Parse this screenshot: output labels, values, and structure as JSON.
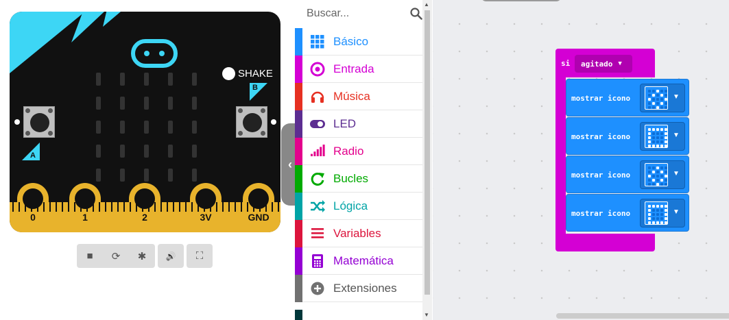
{
  "simulator": {
    "shake_label": "SHAKE",
    "button_a": "A",
    "button_b": "B",
    "pins": [
      "0",
      "1",
      "2",
      "3V",
      "GND"
    ],
    "toolbar": [
      {
        "icon": "stop-icon",
        "glyph": "■"
      },
      {
        "icon": "restart-icon",
        "glyph": "⟳"
      },
      {
        "icon": "debug-icon",
        "glyph": "✱"
      },
      {
        "icon": "sound-icon",
        "glyph": "🔊"
      },
      {
        "icon": "fullscreen-icon",
        "glyph": "⛶"
      }
    ]
  },
  "toolbox": {
    "search_placeholder": "Buscar...",
    "categories": [
      {
        "label": "Básico",
        "color": "#1e90ff",
        "icon": "grid-icon"
      },
      {
        "label": "Entrada",
        "color": "#d400d4",
        "icon": "target-icon"
      },
      {
        "label": "Música",
        "color": "#e63022",
        "icon": "headphones-icon"
      },
      {
        "label": "LED",
        "color": "#5c2d91",
        "icon": "toggle-icon"
      },
      {
        "label": "Radio",
        "color": "#e3008c",
        "icon": "signal-bars-icon"
      },
      {
        "label": "Bucles",
        "color": "#00aa00",
        "icon": "loop-icon"
      },
      {
        "label": "Lógica",
        "color": "#00a4a6",
        "icon": "shuffle-icon"
      },
      {
        "label": "Variables",
        "color": "#dc143c",
        "icon": "lines-icon"
      },
      {
        "label": "Matemática",
        "color": "#9400d3",
        "icon": "calculator-icon"
      },
      {
        "label": "Extensiones",
        "color": "#717171",
        "icon": "plus-circle-icon"
      }
    ]
  },
  "workspace": {
    "event": {
      "keyword": "si",
      "gesture": "agitado"
    },
    "blocks": [
      {
        "label": "mostrar icono",
        "pattern": "diamond"
      },
      {
        "label": "mostrar icono",
        "pattern": "square"
      },
      {
        "label": "mostrar icono",
        "pattern": "diamond"
      },
      {
        "label": "mostrar icono",
        "pattern": "square"
      }
    ]
  }
}
